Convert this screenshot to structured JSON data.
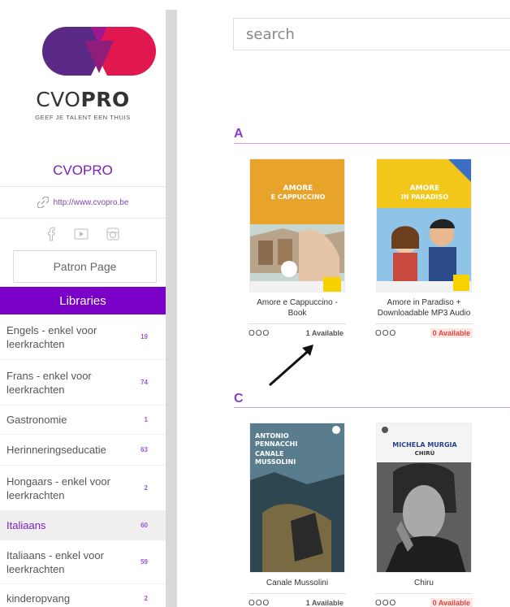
{
  "sidebar": {
    "brand_light": "CVO",
    "brand_bold": "PRO",
    "tagline": "GEEF JE TALENT EEN THUIS",
    "library_name": "CVOPRO",
    "url": "http://www.cvopro.be",
    "patron_label": "Patron Page",
    "libraries_header": "Libraries",
    "libraries": [
      {
        "label": "Engels - enkel voor leerkrachten",
        "count": "19"
      },
      {
        "label": "Frans - enkel voor leerkrachten",
        "count": "74"
      },
      {
        "label": "Gastronomie",
        "count": "1"
      },
      {
        "label": "Herinneringseducatie",
        "count": "63"
      },
      {
        "label": "Hongaars - enkel voor leerkrachten",
        "count": "2"
      },
      {
        "label": "Italiaans",
        "count": "60",
        "active": true
      },
      {
        "label": "Italiaans - enkel voor leerkrachten",
        "count": "59"
      },
      {
        "label": "kinderopvang",
        "count": "2"
      }
    ]
  },
  "search": {
    "placeholder": "search"
  },
  "sections": {
    "a": {
      "letter": "A"
    },
    "c": {
      "letter": "C"
    }
  },
  "books": {
    "b1": {
      "title": "Amore e Cappuccino - Book",
      "cover_title": "AMORE E CAPPUCCINO",
      "dots": "OOO",
      "availability": "1 Available"
    },
    "b2": {
      "title": "Amore in Paradiso + Downloadable MP3 Audio",
      "cover_title": "AMORE IN PARADISO",
      "dots": "OOO",
      "availability": "0 Available"
    },
    "b3": {
      "title": "Canale Mussolini",
      "cover_title": "ANTONIO PENNACCHI CANALE MUSSOLINI",
      "dots": "OOO",
      "availability": "1 Available"
    },
    "b4": {
      "title": "Chiru",
      "cover_title": "MICHELA MURGIA CHIRÙ",
      "dots": "OOO",
      "availability": "0 Available"
    }
  },
  "colors": {
    "accent": "#7b00c7",
    "available_zero": "#e0443a"
  }
}
